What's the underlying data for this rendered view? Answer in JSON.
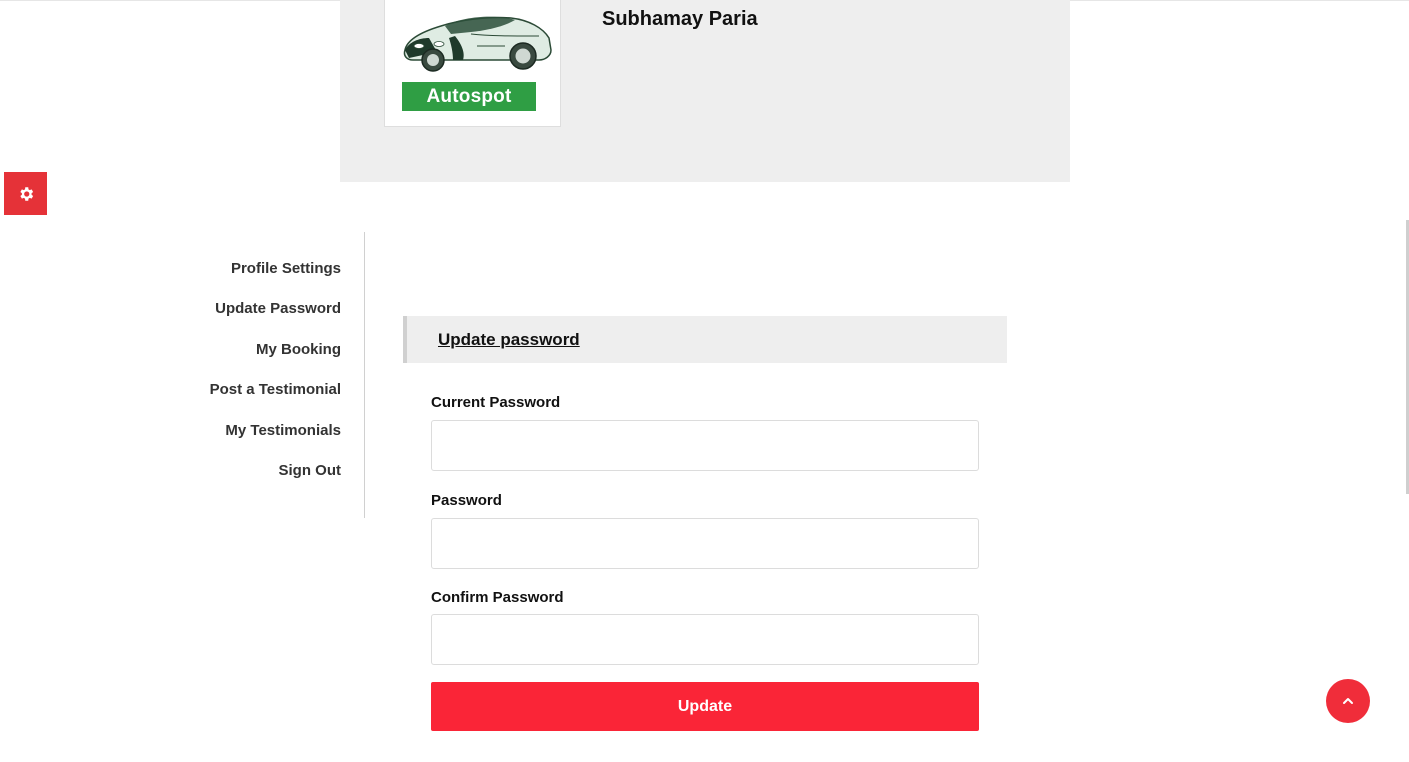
{
  "profile": {
    "brand_badge": "Autospot",
    "user_name": "Subhamay Paria"
  },
  "sidebar": {
    "items": [
      {
        "label": "Profile Settings"
      },
      {
        "label": "Update Password"
      },
      {
        "label": "My Booking"
      },
      {
        "label": "Post a Testimonial"
      },
      {
        "label": "My Testimonials"
      },
      {
        "label": "Sign Out"
      }
    ]
  },
  "form": {
    "section_title": "Update password",
    "current_password_label": "Current Password",
    "current_password_value": "",
    "password_label": "Password",
    "password_value": "",
    "confirm_password_label": "Confirm Password",
    "confirm_password_value": "",
    "submit_label": "Update"
  },
  "colors": {
    "accent": "#fa2537",
    "brand_green": "#2f9e44",
    "panel_bg": "#eeeeee"
  },
  "icons": {
    "settings": "gear-icon",
    "back_to_top": "chevron-up-icon",
    "logo": "car-logo-icon"
  }
}
